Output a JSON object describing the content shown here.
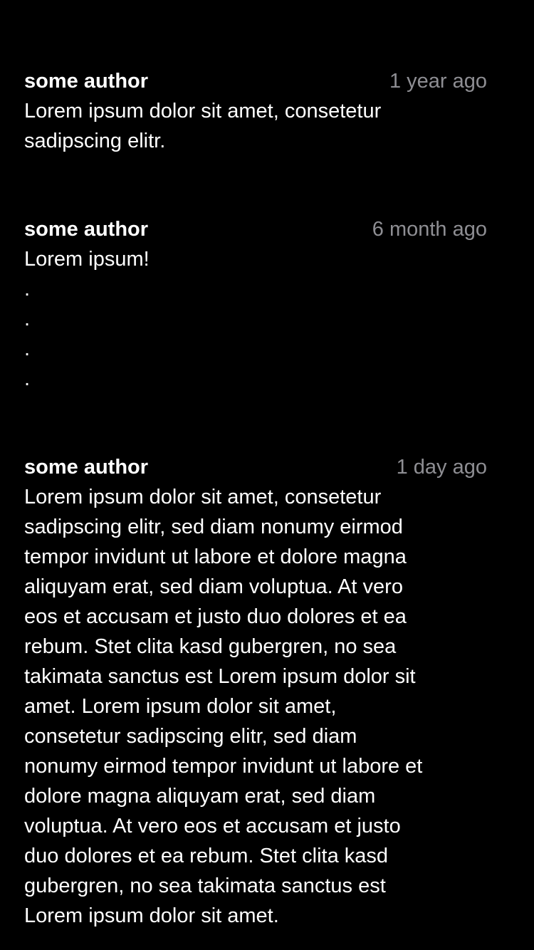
{
  "comments": [
    {
      "author": "some author",
      "time": "1 year ago",
      "text": "Lorem ipsum dolor sit amet, consetetur\nsadipscing elitr."
    },
    {
      "author": "some author",
      "time": "6 month ago",
      "text": "Lorem ipsum!\n.\n.\n.\n."
    },
    {
      "author": "some author",
      "time": "1 day ago",
      "text": "Lorem ipsum dolor sit amet, consetetur\nsadipscing elitr, sed diam nonumy eirmod\ntempor invidunt ut labore et dolore magna\naliquyam erat, sed diam voluptua. At vero\neos et accusam et justo duo dolores et ea\nrebum. Stet clita kasd gubergren, no sea\ntakimata sanctus est Lorem ipsum dolor sit\namet. Lorem ipsum dolor sit amet,\nconsetetur sadipscing elitr, sed diam\nnonumy eirmod tempor invidunt ut labore et\ndolore magna aliquyam erat, sed diam\nvoluptua. At vero eos et accusam et justo\nduo dolores et ea rebum. Stet clita kasd\ngubergren, no sea takimata sanctus est\nLorem ipsum dolor sit amet."
    }
  ]
}
